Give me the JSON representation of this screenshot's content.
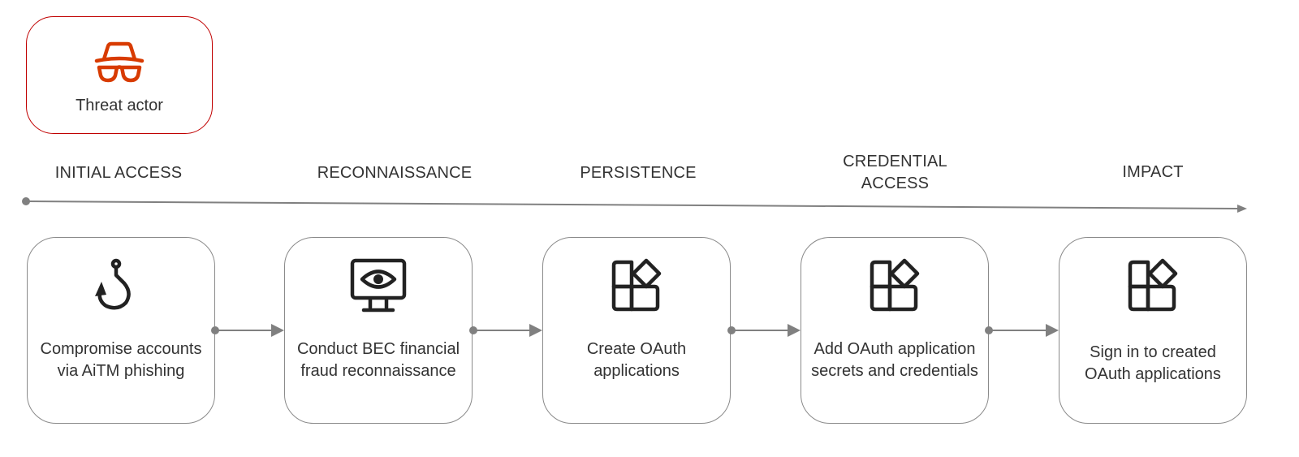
{
  "actor": {
    "label": "Threat actor",
    "icon": "incognito-spy-icon",
    "border_color": "#c00000",
    "icon_color": "#d83b01"
  },
  "phases": [
    {
      "label": "INITIAL ACCESS"
    },
    {
      "label": "RECONNAISSANCE"
    },
    {
      "label": "PERSISTENCE"
    },
    {
      "label": "CREDENTIAL ACCESS"
    },
    {
      "label": "IMPACT"
    }
  ],
  "steps": [
    {
      "label": "Compromise accounts via AiTM phishing",
      "icon": "fishing-hook-icon"
    },
    {
      "label": "Conduct BEC financial fraud reconnaissance",
      "icon": "monitor-eye-icon"
    },
    {
      "label": "Create OAuth applications",
      "icon": "app-grid-icon"
    },
    {
      "label": "Add OAuth application secrets and credentials",
      "icon": "app-grid-icon"
    },
    {
      "label": "Sign in to created OAuth applications",
      "icon": "app-grid-icon"
    }
  ],
  "colors": {
    "line": "#808080",
    "box_border": "#8a8a8a",
    "text": "#333333",
    "icon": "#222222"
  }
}
